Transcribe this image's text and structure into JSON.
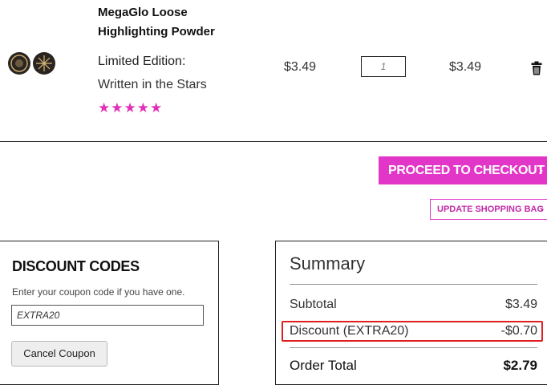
{
  "product": {
    "name": "MegaGlo Loose Highlighting Powder",
    "variant_label": "Limited Edition:",
    "variant_value": "Written in the Stars",
    "rating": "★★★★★",
    "unit_price": "$3.49",
    "quantity": "1",
    "line_total": "$3.49"
  },
  "actions": {
    "checkout_label": "PROCEED TO CHECKOUT",
    "update_label": "UPDATE SHOPPING BAG"
  },
  "discount": {
    "title": "DISCOUNT CODES",
    "help_text": "Enter your coupon code if you have one.",
    "code_value": "EXTRA20",
    "cancel_label": "Cancel Coupon"
  },
  "summary": {
    "title": "Summary",
    "subtotal_label": "Subtotal",
    "subtotal_value": "$3.49",
    "discount_label": "Discount (EXTRA20)",
    "discount_value": "-$0.70",
    "total_label": "Order Total",
    "total_value": "$2.79"
  },
  "colors": {
    "accent": "#e236c8",
    "highlight": "#e02020"
  },
  "icons": {
    "trash": "trash-icon",
    "chevron": "chevron-right-icon"
  }
}
